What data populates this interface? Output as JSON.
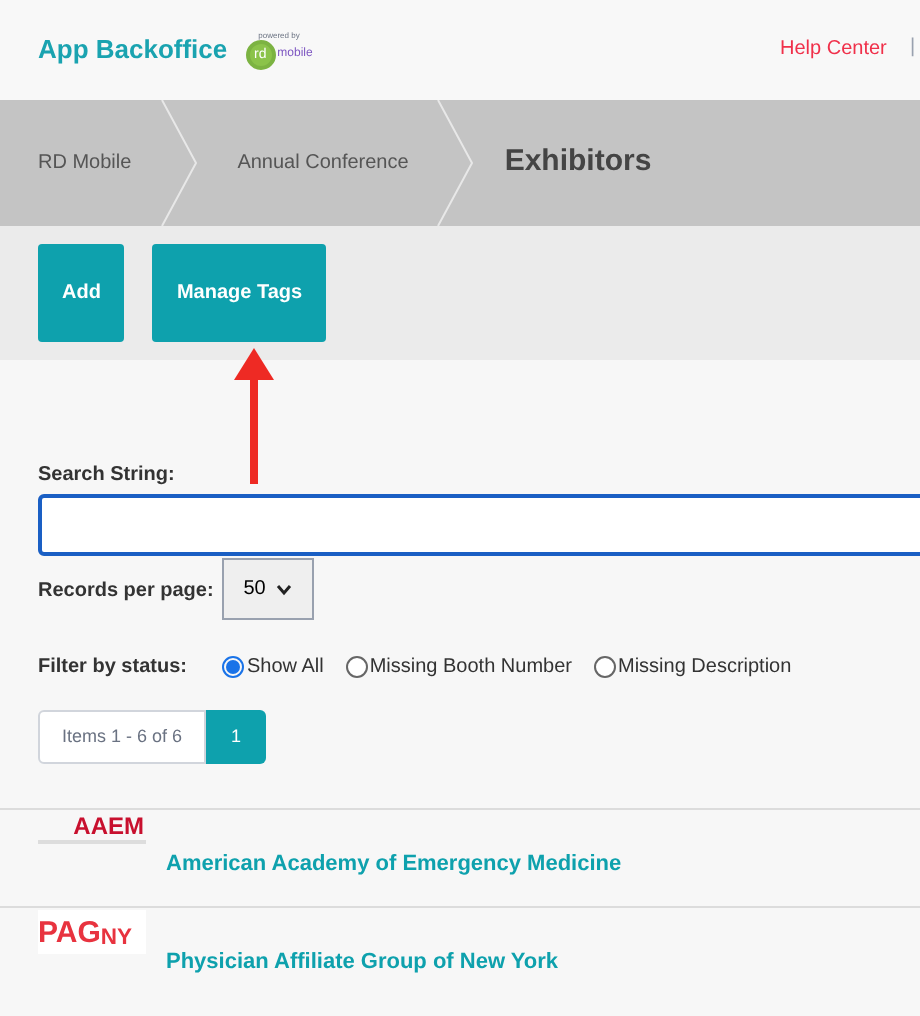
{
  "header": {
    "app_name": "App Backoffice",
    "powered_by": "powered by",
    "logo_mark": "rd",
    "logo_word": "mobile",
    "help_link": "Help Center",
    "separator": "|"
  },
  "breadcrumbs": [
    {
      "label": "RD Mobile",
      "current": false
    },
    {
      "label": "Annual Conference",
      "current": false
    },
    {
      "label": "Exhibitors",
      "current": true
    }
  ],
  "toolbar": {
    "buttons": [
      "Add",
      "Manage Tags"
    ]
  },
  "search": {
    "label": "Search String:",
    "focused": true
  },
  "records": {
    "label": "Records per page:",
    "value": "50"
  },
  "filter": {
    "label": "Filter by status:",
    "options": [
      {
        "label": "Show All",
        "selected": true
      },
      {
        "label": "Missing Booth Number",
        "selected": false
      },
      {
        "label": "Missing Description",
        "selected": false
      }
    ]
  },
  "pagination": {
    "info": "Items 1 - 6 of 6",
    "pages": [
      {
        "label": "1",
        "selected": true
      }
    ]
  },
  "exhibitors": [
    {
      "logo_text": "AAEM",
      "kind": "aaem",
      "name": "American Academy of Emergency Medicine"
    },
    {
      "logo_text": "PAG$_{NY}$",
      "kind": "pag",
      "name": "Physician Affiliate Group of New York"
    }
  ]
}
